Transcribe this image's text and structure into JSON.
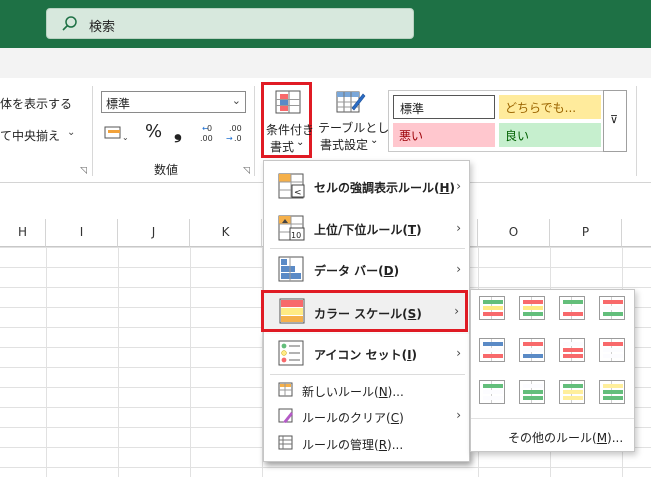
{
  "titlebar": {
    "search_placeholder": "検索"
  },
  "ribbon": {
    "alignment": {
      "show_all_label": "体を表示する",
      "merge_center_label": "て中央揃え"
    },
    "number": {
      "format_value": "標準",
      "percent_symbol": "%",
      "comma_symbol": "❟",
      "group_label": "数値"
    },
    "styles": {
      "conditional_formatting_label_1": "条件付き",
      "conditional_formatting_label_2": "書式",
      "format_table_label_1": "テーブルとして",
      "format_table_label_2": "書式設定",
      "cell_styles": [
        {
          "label": "標準",
          "bg": "#ffffff",
          "fg": "#222222"
        },
        {
          "label": "どちらでも...",
          "bg": "#ffeb9c",
          "fg": "#9c6500"
        },
        {
          "label": "悪い",
          "bg": "#ffc7ce",
          "fg": "#9c0006"
        },
        {
          "label": "良い",
          "bg": "#c6efce",
          "fg": "#006100"
        }
      ]
    }
  },
  "grid": {
    "columns": [
      "H",
      "I",
      "J",
      "K",
      "O",
      "P"
    ]
  },
  "menu": {
    "items": [
      {
        "label": "セルの強調表示ルール(H)",
        "key": "H",
        "pre": "セルの強調表示ルール(",
        "post": ")"
      },
      {
        "label": "上位/下位ルール(T)",
        "key": "T",
        "pre": "上位/下位ルール(",
        "post": ")"
      },
      {
        "label": "データ バー(D)",
        "key": "D",
        "pre": "データ バー(",
        "post": ")"
      },
      {
        "label": "カラー スケール(S)",
        "key": "S",
        "pre": "カラー スケール(",
        "post": ")"
      },
      {
        "label": "アイコン セット(I)",
        "key": "I",
        "pre": "アイコン セット(",
        "post": ")"
      }
    ],
    "small_items": [
      {
        "pre": "新しいルール(",
        "key": "N",
        "post": ")..."
      },
      {
        "pre": "ルールのクリア(",
        "key": "C",
        "post": ")"
      },
      {
        "pre": "ルールの管理(",
        "key": "R",
        "post": ")..."
      }
    ]
  },
  "submenu": {
    "more_rules": {
      "pre": "その他のルール(",
      "key": "M",
      "post": ")..."
    },
    "scales": [
      [
        "#63be7b",
        "#ffeb84",
        "#f8696b"
      ],
      [
        "#f8696b",
        "#ffeb84",
        "#63be7b"
      ],
      [
        "#63be7b",
        "#fcfcff",
        "#f8696b"
      ],
      [
        "#f8696b",
        "#fcfcff",
        "#63be7b"
      ],
      [
        "#5a8ac6",
        "#fcfcff",
        "#f8696b"
      ],
      [
        "#f8696b",
        "#fcfcff",
        "#5a8ac6"
      ],
      [
        "#fcfcff",
        "#f8696b",
        "#f8696b"
      ],
      [
        "#f8696b",
        "#fcfcff",
        "#fcfcff"
      ],
      [
        "#63be7b",
        "#fcfcff",
        "#fcfcff"
      ],
      [
        "#fcfcff",
        "#63be7b",
        "#63be7b"
      ],
      [
        "#63be7b",
        "#ffef9c",
        "#ffef9c"
      ],
      [
        "#ffef9c",
        "#63be7b",
        "#63be7b"
      ]
    ]
  },
  "colors": {
    "title_green": "#1e7145",
    "highlight_red": "#e01b24"
  }
}
